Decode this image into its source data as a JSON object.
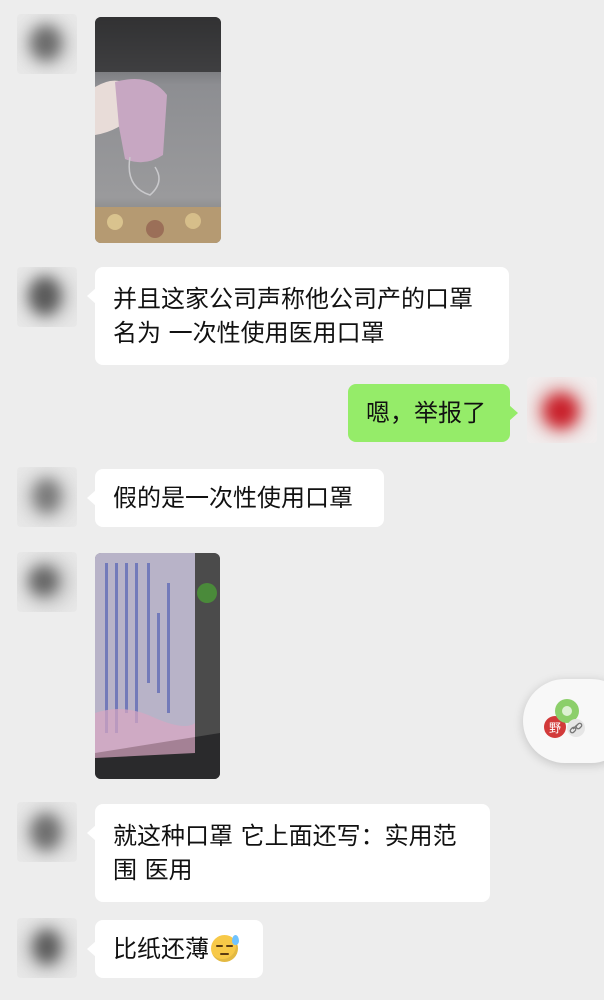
{
  "messages": [
    {
      "id": 1,
      "side": "left",
      "kind": "image",
      "subject": "pink mask held up by a hand"
    },
    {
      "id": 2,
      "side": "left",
      "kind": "text",
      "lines": [
        "并且这家公司声称他公司产的口罩",
        "名为 一次性使用医用口罩"
      ]
    },
    {
      "id": 3,
      "side": "right",
      "kind": "text",
      "lines": [
        "嗯，举报了"
      ]
    },
    {
      "id": 4,
      "side": "left",
      "kind": "text",
      "lines": [
        "假的是一次性使用口罩"
      ]
    },
    {
      "id": 5,
      "side": "left",
      "kind": "image",
      "subject": "mask package with printed label"
    },
    {
      "id": 6,
      "side": "left",
      "kind": "text",
      "lines": [
        "就这种口罩 它上面还写：实用范",
        "围 医用"
      ]
    },
    {
      "id": 7,
      "side": "left",
      "kind": "text",
      "lines": [
        "比纸还薄"
      ],
      "emoji": "sweat-smile-emoji"
    }
  ],
  "floating_widget": {
    "icon": "link-icon"
  },
  "colors": {
    "background": "#ededed",
    "incoming_bubble": "#ffffff",
    "outgoing_bubble": "#95ec69",
    "text": "#111111"
  }
}
